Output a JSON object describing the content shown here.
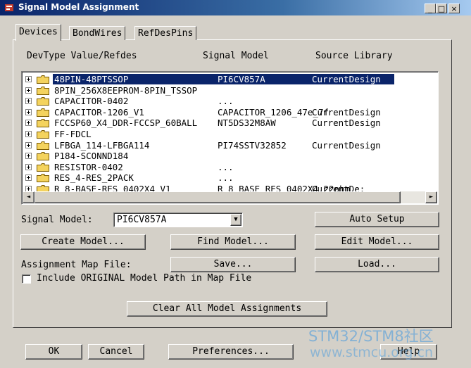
{
  "window": {
    "title": "Signal Model Assignment",
    "buttons": {
      "minimize": "_",
      "maximize": "□",
      "close": "×"
    }
  },
  "tabs": [
    {
      "label": "Devices",
      "active": true
    },
    {
      "label": "BondWires",
      "active": false
    },
    {
      "label": "RefDesPins",
      "active": false
    }
  ],
  "columns": {
    "devtype": "DevType Value/Refdes",
    "signal_model": "Signal Model",
    "source_library": "Source Library"
  },
  "rows": [
    {
      "devtype": "48PIN-48PTSSOP",
      "model": "PI6CV857A",
      "library": "CurrentDesign",
      "selected": true
    },
    {
      "devtype": "8PIN_256X8EEPROM-8PIN_TSSOP",
      "model": "",
      "library": "",
      "selected": false
    },
    {
      "devtype": "CAPACITOR-0402",
      "model": "...",
      "library": "",
      "selected": false
    },
    {
      "devtype": "CAPACITOR-1206_V1",
      "model": "CAPACITOR_1206_47e_7f",
      "library": "CurrentDesign",
      "selected": false
    },
    {
      "devtype": "FCCSP60_X4_DDR-FCCSP_60BALL",
      "model": "NT5DS32M8AW",
      "library": "CurrentDesign",
      "selected": false
    },
    {
      "devtype": "FF-FDCL",
      "model": "",
      "library": "",
      "selected": false
    },
    {
      "devtype": "LFBGA_114-LFBGA114",
      "model": "PI74SSTV32852",
      "library": "CurrentDesign",
      "selected": false
    },
    {
      "devtype": "P184-SCONND184",
      "model": "",
      "library": "",
      "selected": false
    },
    {
      "devtype": "RESISTOR-0402",
      "model": "...",
      "library": "",
      "selected": false
    },
    {
      "devtype": "RES_4-RES_2PACK",
      "model": "...",
      "library": "",
      "selected": false
    },
    {
      "devtype": "R_8-BASE-RES_0402X4_V1",
      "model": "R_8_BASE_RES_0402X4_22ohm",
      "library": "CurrentDe:",
      "selected": false
    }
  ],
  "scrollbar": {
    "left_arrow": "◄",
    "right_arrow": "►"
  },
  "signal_model": {
    "label": "Signal Model:",
    "value": "PI6CV857A",
    "dropdown_arrow": "▼"
  },
  "buttons": {
    "auto_setup": "Auto Setup",
    "create_model": "Create Model...",
    "find_model": "Find Model...",
    "edit_model": "Edit Model...",
    "save": "Save...",
    "load": "Load...",
    "clear_all": "Clear All Model Assignments",
    "ok": "OK",
    "cancel": "Cancel",
    "preferences": "Preferences...",
    "help": "Help"
  },
  "assignment_map_label": "Assignment Map File:",
  "include_original_label": "Include ORIGINAL Model Path in Map File",
  "include_original_checked": false,
  "watermark": {
    "line1": "STM32/STM8社区",
    "line2": "www.stmcu.org.cn"
  },
  "colors": {
    "selection": "#0a246a",
    "titlebar": "#0a246a",
    "folder": "#f4d35e"
  }
}
